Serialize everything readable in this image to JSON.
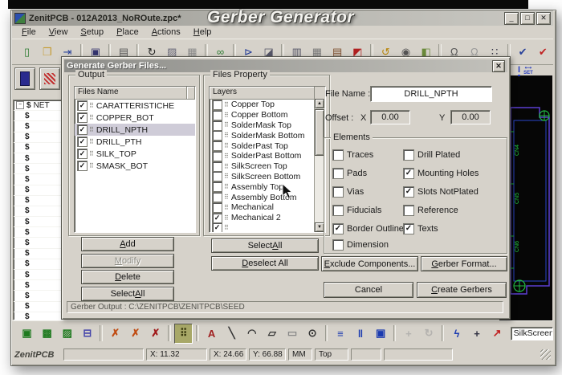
{
  "overlay": {
    "title": "Gerber Generator"
  },
  "window": {
    "title": "ZenitPCB - 012A2013_NoROute.zpc*",
    "controls": [
      {
        "name": "minimize-button",
        "glyph": "_"
      },
      {
        "name": "maximize-button",
        "glyph": "□"
      },
      {
        "name": "close-button",
        "glyph": "✕"
      }
    ]
  },
  "menu": {
    "items": [
      {
        "label": "File",
        "u": 0
      },
      {
        "label": "View",
        "u": 0
      },
      {
        "label": "Setup",
        "u": 0
      },
      {
        "label": "Place",
        "u": 0
      },
      {
        "label": "Actions",
        "u": 0
      },
      {
        "label": "Help",
        "u": 0
      }
    ]
  },
  "toolbar_top": {
    "icons": [
      {
        "n": "new-file-icon",
        "g": "▯",
        "c": "#2e7d32"
      },
      {
        "n": "open-folder-icon",
        "g": "❒",
        "c": "#c59a2e"
      },
      {
        "n": "import-icon",
        "g": "⇥",
        "c": "#27409a",
        "sep": true
      },
      {
        "n": "save-icon",
        "g": "▣",
        "c": "#34346e",
        "sep": true
      },
      {
        "n": "print-icon",
        "g": "▤",
        "c": "#555555",
        "sep": true
      },
      {
        "n": "refresh-icon",
        "g": "↻",
        "c": "#222222"
      },
      {
        "n": "paste-special-icon",
        "g": "▨",
        "c": "#666677"
      },
      {
        "n": "grid-icon",
        "g": "▦",
        "c": "#8a8a8a",
        "sep": true
      },
      {
        "n": "net-connect-icon",
        "g": "∞",
        "c": "#2e7d32",
        "sep": true
      },
      {
        "n": "export-icon",
        "g": "⊳",
        "c": "#27409a"
      },
      {
        "n": "edit-sheet-icon",
        "g": "◪",
        "c": "#555566",
        "sep": true
      },
      {
        "n": "report-icon",
        "g": "▥",
        "c": "#555566"
      },
      {
        "n": "grid-table-icon",
        "g": "▦",
        "c": "#777777"
      },
      {
        "n": "library-icon",
        "g": "▤",
        "c": "#7a4a2a"
      },
      {
        "n": "layer-colors-icon",
        "g": "◩",
        "c": "#b02020",
        "sep": true
      },
      {
        "n": "rotate-icon",
        "g": "↺",
        "c": "#b8860b"
      },
      {
        "n": "snapshot-icon",
        "g": "◉",
        "c": "#555555"
      },
      {
        "n": "component-icon",
        "g": "◧",
        "c": "#6a8a3a",
        "sep": true
      },
      {
        "n": "lock-icon",
        "g": "Ω",
        "c": "#555555"
      },
      {
        "n": "unlock-icon",
        "g": "Ω",
        "c": "#999999"
      },
      {
        "n": "snap-icon",
        "g": "∷",
        "c": "#333344",
        "sep": true
      },
      {
        "n": "pro-check-icon",
        "g": "✔",
        "c": "#27409a"
      },
      {
        "n": "drc-check-icon",
        "g": "✔",
        "c": "#c02020"
      }
    ]
  },
  "side_toolbar": {
    "icons": [
      {
        "n": "pad-tool-icon"
      },
      {
        "n": "hatch-tool-icon"
      }
    ]
  },
  "tree": {
    "root_symbol": "$",
    "root_label": "NET",
    "row_symbol": "$",
    "row_count": 21
  },
  "dialog": {
    "title": "Generate Gerber Files...",
    "close_glyph": "✕",
    "output_group": {
      "label": "Output",
      "header": "Files Name",
      "files": [
        {
          "name": "CARATTERISTICHE",
          "checked": true,
          "selected": false
        },
        {
          "name": "COPPER_BOT",
          "checked": true,
          "selected": false
        },
        {
          "name": "DRILL_NPTH",
          "checked": true,
          "selected": true
        },
        {
          "name": "DRILL_PTH",
          "checked": true,
          "selected": false
        },
        {
          "name": "SILK_TOP",
          "checked": true,
          "selected": false
        },
        {
          "name": "SMASK_BOT",
          "checked": true,
          "selected": false
        }
      ],
      "buttons": [
        {
          "label": "Add",
          "u": 0,
          "enabled": true
        },
        {
          "label": "Modify",
          "u": 0,
          "enabled": false
        },
        {
          "label": "Delete",
          "u": 0,
          "enabled": true
        },
        {
          "label": "Select All",
          "u": 7,
          "enabled": true
        }
      ]
    },
    "files_property_group": {
      "label": "Files Property",
      "header": "Layers",
      "layers": [
        {
          "name": "Copper Top",
          "checked": false
        },
        {
          "name": "Copper Bottom",
          "checked": false
        },
        {
          "name": "SolderMask Top",
          "checked": false
        },
        {
          "name": "SolderMask Bottom",
          "checked": false
        },
        {
          "name": "SolderPast Top",
          "checked": false
        },
        {
          "name": "SolderPast Bottom",
          "checked": false
        },
        {
          "name": "SilkScreen Top",
          "checked": false
        },
        {
          "name": "SilkScreen Bottom",
          "checked": false
        },
        {
          "name": "Assembly Top",
          "checked": false
        },
        {
          "name": "Assembly Bottom",
          "checked": false
        },
        {
          "name": "Mechanical",
          "checked": false
        },
        {
          "name": "Mechanical 2",
          "checked": true
        },
        {
          "name": "",
          "checked": true
        }
      ],
      "buttons": [
        {
          "label": "Select All",
          "u": 7,
          "enabled": true
        },
        {
          "label": "Deselect All",
          "u": 0,
          "enabled": true
        }
      ]
    },
    "file_name": {
      "label": "File Name :",
      "value": "DRILL_NPTH"
    },
    "offset": {
      "label": "Offset :",
      "x_label": "X",
      "x_value": "0.00",
      "y_label": "Y",
      "y_value": "0.00"
    },
    "elements_group": {
      "label": "Elements",
      "left": [
        {
          "label": "Traces",
          "checked": false
        },
        {
          "label": "Pads",
          "checked": false
        },
        {
          "label": "Vias",
          "checked": false
        },
        {
          "label": "Fiducials",
          "checked": false
        },
        {
          "label": "Border Outline",
          "checked": true
        },
        {
          "label": "Dimension",
          "checked": false
        }
      ],
      "right": [
        {
          "label": "Drill Plated",
          "checked": false
        },
        {
          "label": "Mounting Holes",
          "checked": true
        },
        {
          "label": "Slots NotPlated",
          "checked": true
        },
        {
          "label": "Reference",
          "checked": false
        },
        {
          "label": "Texts",
          "checked": true
        }
      ]
    },
    "buttons": {
      "exclude": {
        "label": "Exclude Components...",
        "u": 0
      },
      "format": {
        "label": "Gerber Format...",
        "u": 0
      },
      "cancel": {
        "label": "Cancel"
      },
      "create": {
        "label": "Create Gerbers",
        "u": 0
      }
    },
    "gerber_output": "Gerber Output : C:\\ZENITPCB\\ZENITPCB\\SEED"
  },
  "pcb_view": {
    "labels": [
      "CN4",
      "CN5",
      "CN6"
    ]
  },
  "right_toolbar": {
    "icons": [
      {
        "n": "cursor-info-icon",
        "g": "I"
      },
      {
        "n": "set-measure-icon",
        "g": "SET"
      }
    ]
  },
  "bottom_toolbar": {
    "icons": [
      {
        "n": "place-component-icon",
        "g": "▣",
        "c": "#1f7a1f"
      },
      {
        "n": "place-library-part-icon",
        "g": "▩",
        "c": "#1f7a1f"
      },
      {
        "n": "route-icon",
        "g": "▨",
        "c": "#1f7a1f"
      },
      {
        "n": "copy-route-icon",
        "g": "⊟",
        "c": "#4444aa",
        "sep": true
      },
      {
        "n": "delete-component-icon",
        "g": "✗",
        "c": "#c04a10"
      },
      {
        "n": "delete-route-icon",
        "g": "✗",
        "c": "#c04a10"
      },
      {
        "n": "delete-all-icon",
        "g": "✗",
        "c": "#a01818",
        "sep": true
      },
      {
        "n": "footprint-mode-icon",
        "g": "⠿",
        "c": "#3a3a10",
        "pressed": true,
        "sep": true
      },
      {
        "n": "text-tool-icon",
        "g": "A",
        "c": "#a02020"
      },
      {
        "n": "line-tool-icon",
        "g": "╲",
        "c": "#333333"
      },
      {
        "n": "arc-tool-icon",
        "g": "◠",
        "c": "#333333"
      },
      {
        "n": "polygon-tool-icon",
        "g": "▱",
        "c": "#333333"
      },
      {
        "n": "rect-tool-icon",
        "g": "▭",
        "c": "#888888"
      },
      {
        "n": "circle-tool-icon",
        "g": "⊙",
        "c": "#333333",
        "sep": true
      },
      {
        "n": "align-horizontal-icon",
        "g": "≡",
        "c": "#1a3ab0"
      },
      {
        "n": "align-vertical-icon",
        "g": "‖",
        "c": "#1a3ab0"
      },
      {
        "n": "highlight-grid-icon",
        "g": "▣",
        "c": "#1a3ab0",
        "sep": true
      },
      {
        "n": "move-icon",
        "g": "+",
        "c": "#999999",
        "disabled": true
      },
      {
        "n": "rotate-part-icon",
        "g": "↻",
        "c": "#999999",
        "disabled": true,
        "sep": true
      },
      {
        "n": "autoroute-icon",
        "g": "ϟ",
        "c": "#1a3ab0"
      },
      {
        "n": "add-node-icon",
        "g": "+",
        "c": "#333344"
      },
      {
        "n": "measure-icon",
        "g": "↗",
        "c": "#c02020"
      }
    ],
    "layer_combo": "SilkScreen"
  },
  "status_bar": {
    "app": "ZenitPCB",
    "fields": [
      "",
      "X: 11.32",
      "X: 24.66",
      "Y: 66.88",
      "MM",
      "Top",
      "",
      ""
    ]
  }
}
